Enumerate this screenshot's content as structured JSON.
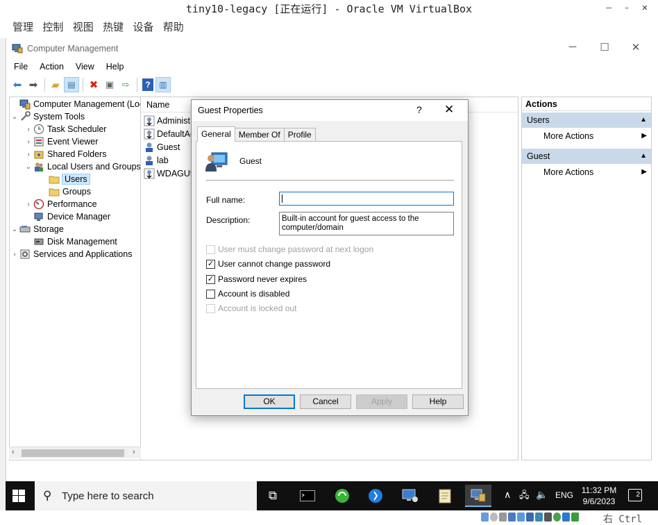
{
  "host": {
    "window_title": "tiny10-legacy [正在运行] - Oracle VM VirtualBox",
    "menu": [
      "管理",
      "控制",
      "视图",
      "热键",
      "设备",
      "帮助"
    ],
    "host_key": "右 Ctrl"
  },
  "mmc": {
    "title": "Computer Management",
    "menu": [
      "File",
      "Action",
      "View",
      "Help"
    ],
    "tree": [
      {
        "label": "Computer Management (Local",
        "icon": "computer-management-icon"
      },
      {
        "label": "System Tools",
        "icon": "tools-icon"
      },
      {
        "label": "Task Scheduler",
        "icon": "clock-icon"
      },
      {
        "label": "Event Viewer",
        "icon": "event-viewer-icon"
      },
      {
        "label": "Shared Folders",
        "icon": "shared-folder-icon"
      },
      {
        "label": "Local Users and Groups",
        "icon": "users-groups-icon"
      },
      {
        "label": "Users",
        "icon": "folder-icon"
      },
      {
        "label": "Groups",
        "icon": "folder-icon"
      },
      {
        "label": "Performance",
        "icon": "performance-icon"
      },
      {
        "label": "Device Manager",
        "icon": "device-manager-icon"
      },
      {
        "label": "Storage",
        "icon": "storage-icon"
      },
      {
        "label": "Disk Management",
        "icon": "disk-icon"
      },
      {
        "label": "Services and Applications",
        "icon": "services-icon"
      }
    ],
    "list_header": "Name",
    "list_items": [
      "Administ",
      "DefaultAc",
      "Guest",
      "lab",
      "WDAGUti"
    ],
    "actions": {
      "header": "Actions",
      "sections": [
        {
          "title": "Users",
          "item": "More Actions"
        },
        {
          "title": "Guest",
          "item": "More Actions"
        }
      ]
    }
  },
  "dialog": {
    "title": "Guest Properties",
    "help": "?",
    "tabs": [
      "General",
      "Member Of",
      "Profile"
    ],
    "user_name": "Guest",
    "full_name_label": "Full name:",
    "full_name_value": "",
    "description_label": "Description:",
    "description_value": "Built-in account for guest access to the computer/domain",
    "checkboxes": [
      {
        "label": "User must change password at next logon",
        "checked": false,
        "disabled": true
      },
      {
        "label": "User cannot change password",
        "checked": true,
        "disabled": false
      },
      {
        "label": "Password never expires",
        "checked": true,
        "disabled": false
      },
      {
        "label": "Account is disabled",
        "checked": false,
        "disabled": false
      },
      {
        "label": "Account is locked out",
        "checked": false,
        "disabled": true
      }
    ],
    "buttons": {
      "ok": "OK",
      "cancel": "Cancel",
      "apply": "Apply",
      "help": "Help"
    }
  },
  "taskbar": {
    "search_placeholder": "Type here to search",
    "language": "ENG",
    "time": "11:32 PM",
    "date": "9/6/2023",
    "notifications": "2"
  }
}
